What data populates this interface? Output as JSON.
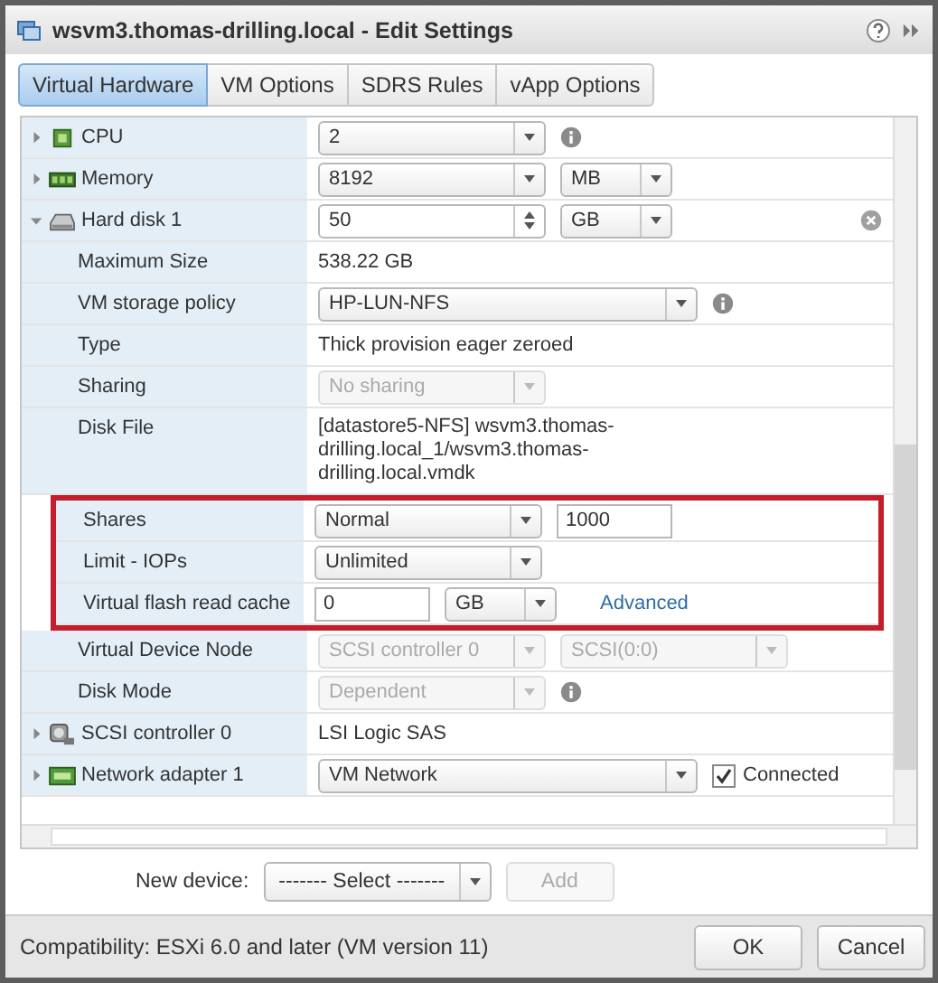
{
  "window": {
    "title": "wsvm3.thomas-drilling.local - Edit Settings"
  },
  "tabs": [
    {
      "label": "Virtual Hardware",
      "selected": true
    },
    {
      "label": "VM Options",
      "selected": false
    },
    {
      "label": "SDRS Rules",
      "selected": false
    },
    {
      "label": "vApp Options",
      "selected": false
    }
  ],
  "rows": [
    {
      "label": "CPU",
      "expanded": false,
      "highlighted": false,
      "controls": [
        {
          "kind": "combo",
          "value": "2",
          "disabled": false
        },
        {
          "kind": "info"
        }
      ]
    },
    {
      "label": "Memory",
      "expanded": false,
      "highlighted": false,
      "controls": [
        {
          "kind": "combo",
          "value": "8192",
          "disabled": false
        },
        {
          "kind": "unit-combo",
          "value": "MB",
          "disabled": false
        }
      ]
    },
    {
      "label": "Hard disk 1",
      "expanded": true,
      "highlighted": false,
      "controls": [
        {
          "kind": "spin",
          "value": "50"
        },
        {
          "kind": "unit-combo",
          "value": "GB",
          "disabled": false
        },
        {
          "kind": "remove"
        }
      ],
      "children": [
        {
          "label": "Maximum Size",
          "highlighted": false,
          "controls": [
            {
              "kind": "text",
              "value": "538.22 GB"
            }
          ]
        },
        {
          "label": "VM storage policy",
          "highlighted": false,
          "controls": [
            {
              "kind": "wide-combo",
              "value": "HP-LUN-NFS",
              "disabled": false
            },
            {
              "kind": "info"
            }
          ]
        },
        {
          "label": "Type",
          "highlighted": false,
          "controls": [
            {
              "kind": "text",
              "value": "Thick provision eager zeroed"
            }
          ]
        },
        {
          "label": "Sharing",
          "highlighted": false,
          "controls": [
            {
              "kind": "combo",
              "value": "No sharing",
              "disabled": true
            }
          ]
        },
        {
          "label": "Disk File",
          "highlighted": false,
          "controls": [
            {
              "kind": "text",
              "value": "[datastore5-NFS] wsvm3.thomas-drilling.local_1/wsvm3.thomas-drilling.local.vmdk"
            }
          ]
        },
        {
          "label": "Shares",
          "highlighted": true,
          "controls": [
            {
              "kind": "combo",
              "value": "Normal",
              "disabled": false
            },
            {
              "kind": "input",
              "value": "1000"
            }
          ]
        },
        {
          "label": "Limit - IOPs",
          "highlighted": true,
          "controls": [
            {
              "kind": "combo",
              "value": "Unlimited",
              "disabled": false
            }
          ]
        },
        {
          "label": "Virtual flash read cache",
          "highlighted": true,
          "controls": [
            {
              "kind": "input",
              "value": "0"
            },
            {
              "kind": "unit-combo",
              "value": "GB",
              "disabled": false
            },
            {
              "kind": "link",
              "value": "Advanced"
            }
          ]
        },
        {
          "label": "Virtual Device Node",
          "highlighted": false,
          "controls": [
            {
              "kind": "combo",
              "value": "SCSI controller 0",
              "disabled": true
            },
            {
              "kind": "combo",
              "value": "SCSI(0:0)",
              "disabled": true
            }
          ]
        },
        {
          "label": "Disk Mode",
          "highlighted": false,
          "controls": [
            {
              "kind": "combo",
              "value": "Dependent",
              "disabled": true
            },
            {
              "kind": "info"
            }
          ]
        }
      ]
    },
    {
      "label": "SCSI controller 0",
      "expanded": false,
      "highlighted": false,
      "controls": [
        {
          "kind": "text",
          "value": "LSI Logic SAS"
        }
      ]
    },
    {
      "label": "Network adapter 1",
      "expanded": false,
      "highlighted": false,
      "controls": [
        {
          "kind": "wide-combo",
          "value": "VM Network",
          "disabled": false
        },
        {
          "kind": "checkbox",
          "label": "Connected",
          "checked": true
        }
      ]
    }
  ],
  "new_device": {
    "label": "New device:",
    "select": "------- Select -------",
    "add": "Add"
  },
  "footer": {
    "compatibility": "Compatibility: ESXi 6.0 and later (VM version 11)",
    "buttons": [
      "OK",
      "Cancel"
    ]
  }
}
